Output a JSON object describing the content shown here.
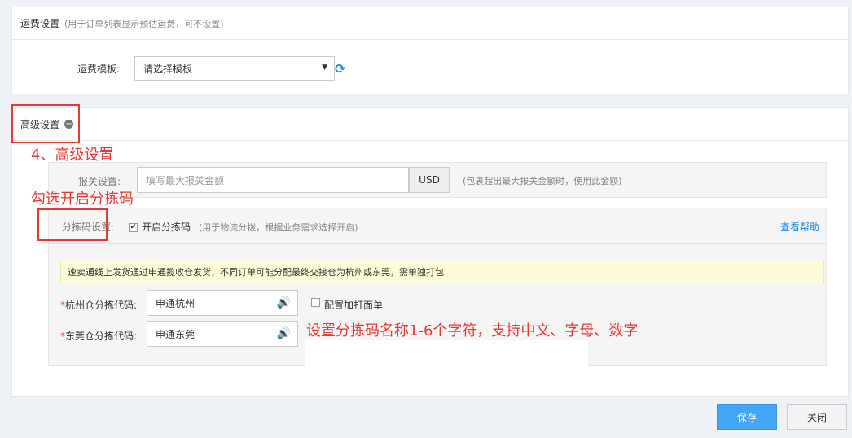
{
  "freight": {
    "title": "运费设置",
    "hint": "(用于订单列表显示预估运费，可不设置)",
    "template_label": "运费模板:",
    "template_value": "请选择模板"
  },
  "advanced": {
    "title": "高级设置",
    "customs_label": "报关设置:",
    "customs_placeholder": "填写最大报关金额",
    "currency": "USD",
    "customs_hint": "(包裹超出最大报关金额时，使用此金额)",
    "sort_label": "分拣码设置:",
    "sort_enable_label": "开启分拣码",
    "sort_hint": "(用于物流分拨，根据业务需求选择开启)",
    "help_link": "查看帮助",
    "notice": "速卖通线上发货通过申通揽收仓发货，不同订单可能分配最终交接仓为杭州或东莞，需单独打包",
    "hangzhou_label": "杭州仓分拣代码:",
    "hangzhou_value": "申通杭州",
    "dongguan_label": "东莞仓分拣代码:",
    "dongguan_value": "申通东莞",
    "print_label": "配置加打面单",
    "required_mark": "*"
  },
  "annotations": {
    "step4": "4、高级设置",
    "check_sort": "勾选开启分拣码",
    "sort_rule": "设置分拣码名称1-6个字符，支持中文、字母、数字"
  },
  "buttons": {
    "save": "保存",
    "close": "关闭"
  },
  "colors": {
    "accent": "#1e88e5",
    "primary_button": "#42a5f5",
    "annotation_red": "#e53935",
    "notice_bg": "#fefcd8"
  }
}
